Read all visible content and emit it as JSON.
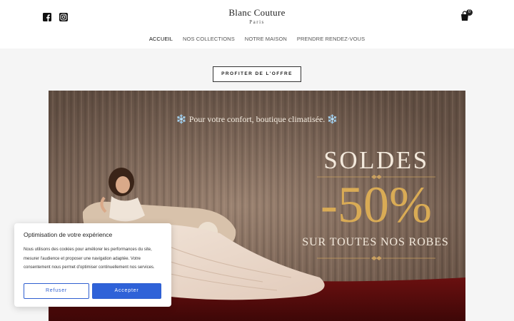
{
  "header": {
    "brand": "Blanc Couture",
    "city": "Paris",
    "cart_count": "0",
    "social": [
      {
        "icon": "facebook-icon"
      },
      {
        "icon": "instagram-icon"
      }
    ]
  },
  "nav": {
    "items": [
      {
        "label": "ACCUEIL",
        "active": true
      },
      {
        "label": "NOS COLLECTIONS"
      },
      {
        "label": "NOTRE MAISON"
      },
      {
        "label": "PRENDRE RENDEZ-VOUS"
      }
    ]
  },
  "cta": {
    "label": "PROFITER DE L'OFFRE"
  },
  "banner": {
    "comfort_text": "❄️ Pour votre confort, boutique climatisée. ❄️",
    "headline": "SOLDES",
    "discount": "-50%",
    "subline": "SUR TOUTES NOS ROBES",
    "colors": {
      "curtain": "#8a7262",
      "gold": "#d9ab55",
      "carpet": "#5a0d0d"
    }
  },
  "cookie": {
    "title": "Optimisation de votre expérience",
    "text": "Nous utilisons des cookies pour améliorer les performances du site, mesurer l'audience et proposer une navigation adaptée. Votre consentement nous permet d'optimiser continuellement nos services.",
    "refuse_label": "Refuser",
    "accept_label": "Accepter",
    "accent": "#2f62d8"
  }
}
